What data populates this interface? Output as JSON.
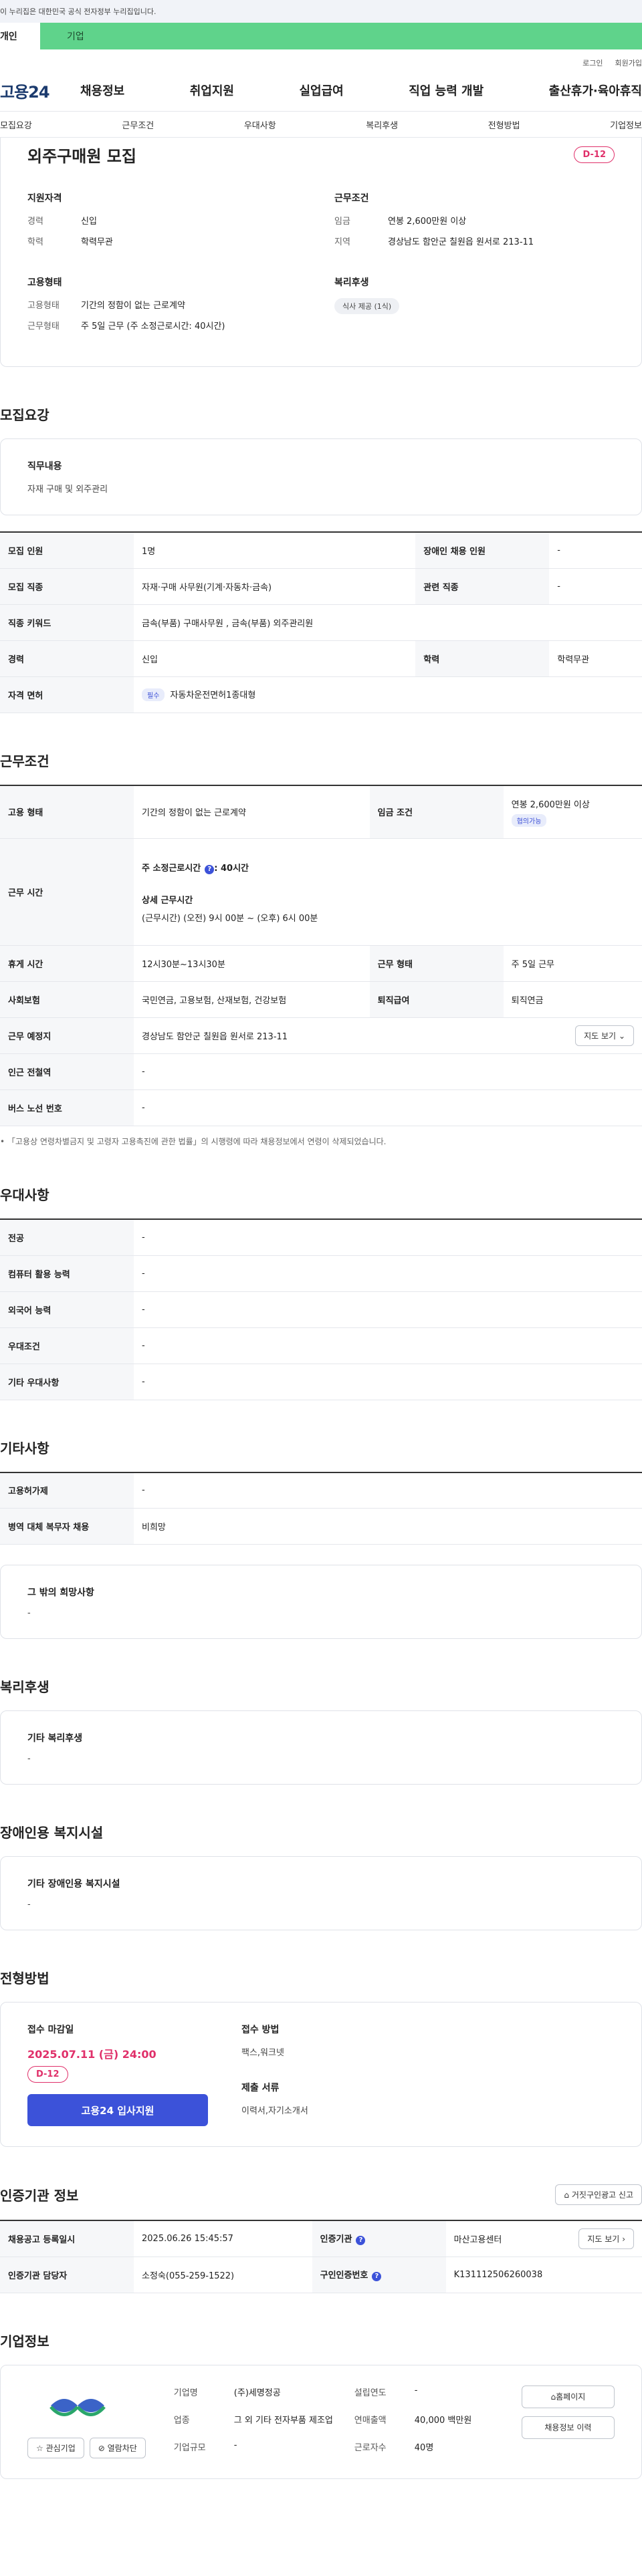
{
  "gov_bar": {
    "text": "이 누리집은 대한민국 공식 전자정부 누리집입니다."
  },
  "tabs": {
    "personal": "개인",
    "company": "기업"
  },
  "util": {
    "login": "로그인",
    "join": "회원가입"
  },
  "logo": "고용24",
  "main_menu": [
    "채용정보",
    "취업지원",
    "실업급여",
    "직업 능력 개발",
    "출산휴가·육아휴직"
  ],
  "sub_menu": [
    "모집요강",
    "근무조건",
    "우대사항",
    "복리후생",
    "전형방법",
    "기업정보"
  ],
  "summary": {
    "title": "외주구매원 모집",
    "dday": "D-12",
    "qualification": {
      "title": "지원자격",
      "career_k": "경력",
      "career_v": "신입",
      "edu_k": "학력",
      "edu_v": "학력무관"
    },
    "conditions": {
      "title": "근무조건",
      "wage_k": "임금",
      "wage_v": "연봉 2,600만원 이상",
      "region_k": "지역",
      "region_v": "경상남도 함안군 칠원읍 원서로 213-11"
    },
    "employment": {
      "title": "고용형태",
      "type_k": "고용형태",
      "type_v": "기간의 정함이 없는 근로계약",
      "work_k": "근무형태",
      "work_v": "주 5일 근무 (주 소정근로시간: 40시간)"
    },
    "welfare": {
      "title": "복리후생",
      "chip": "식사 제공 (1식)"
    }
  },
  "recruit": {
    "section": "모집요강",
    "duty_label": "직무내용",
    "duty_value": "자재 구매 및 외주관리",
    "rows": {
      "headcount_k": "모집 인원",
      "headcount_v": "1명",
      "disabled_k": "장애인 채용 인원",
      "disabled_v": "-",
      "job_k": "모집 직종",
      "job_v": "자재·구매 사무원(기계·자동차·금속)",
      "related_k": "관련 직종",
      "related_v": "-",
      "keyword_k": "직종 키워드",
      "keyword_v": "금속(부품) 구매사무원 , 금속(부품) 외주관리원",
      "career_k": "경력",
      "career_v": "신입",
      "edu_k": "학력",
      "edu_v": "학력무관",
      "license_k": "자격 면허",
      "license_tag": "필수",
      "license_v": "자동차운전면허1종대형"
    }
  },
  "work": {
    "section": "근무조건",
    "type_k": "고용 형태",
    "type_v": "기간의 정함이 없는 근로계약",
    "wage_k": "임금 조건",
    "wage_v": "연봉 2,600만원 이상",
    "wage_tag": "협의가능",
    "hours_k": "근무 시간",
    "hours_total": "주 소정근로시간",
    "hours_total_v": ": 40시간",
    "hours_detail_title": "상세 근무시간",
    "hours_detail_v": "(근무시간) (오전) 9시 00분 ~ (오후) 6시 00분",
    "break_k": "휴게 시간",
    "break_v": "12시30분~13시30분",
    "shift_k": "근무 형태",
    "shift_v": "주 5일 근무",
    "insurance_k": "사회보험",
    "insurance_v": "국민연금, 고용보험, 산재보험, 건강보험",
    "severance_k": "퇴직급여",
    "severance_v": "퇴직연금",
    "place_k": "근무 예정지",
    "place_v": "경상남도 함안군 칠원읍 원서로 213-11",
    "map_btn": "지도 보기",
    "station_k": "인근 전철역",
    "station_v": "-",
    "bus_k": "버스 노선 번호",
    "bus_v": "-",
    "note": "「고용상 연령차별금지 및 고령자 고용촉진에 관한 법률」의 시행령에 따라 채용정보에서 연령이 삭제되었습니다."
  },
  "preference": {
    "section": "우대사항",
    "major_k": "전공",
    "major_v": "-",
    "computer_k": "컴퓨터 활용 능력",
    "computer_v": "-",
    "lang_k": "외국어 능력",
    "lang_v": "-",
    "cond_k": "우대조건",
    "cond_v": "-",
    "etc_k": "기타 우대사항",
    "etc_v": "-"
  },
  "other": {
    "section": "기타사항",
    "subsidy_k": "고용허가제",
    "subsidy_v": "-",
    "military_k": "병역 대체 복무자 채용",
    "military_v": "비희망",
    "wish_label": "그 밖의 희망사항",
    "wish_v": "-"
  },
  "benefits": {
    "section": "복리후생",
    "label": "기타 복리후생",
    "value": "-"
  },
  "disabled_facility": {
    "section": "장애인용 복지시설",
    "label": "기타 장애인용 복지시설",
    "value": "-"
  },
  "selection": {
    "section": "전형방법",
    "deadline_label": "접수 마감일",
    "deadline": "2025.07.11 (금) 24:00",
    "dday": "D-12",
    "apply_btn": "고용24 입사지원",
    "method_label": "접수 방법",
    "method_v": "팩스,워크넷",
    "docs_label": "제출 서류",
    "docs_v": "이력서,자기소개서"
  },
  "agency": {
    "section": "인증기관 정보",
    "report_btn": "거짓구인광고 신고",
    "date_k": "채용공고 등록일시",
    "date_v": "2025.06.26 15:45:57",
    "org_k": "인증기관",
    "org_v": "마산고용센터",
    "map_btn": "지도 보기",
    "manager_k": "인증기관 담당자",
    "manager_v": "소정숙(055-259-1522)",
    "number_k": "구인인증번호",
    "number_v": "K131112506260038"
  },
  "company": {
    "section": "기업정보",
    "fav_btn": "관심기업",
    "block_btn": "열람차단",
    "name_k": "기업명",
    "name_v": "(주)세명정공",
    "year_k": "설립연도",
    "year_v": "-",
    "biz_k": "업종",
    "biz_v": "그 외 기타 전자부품 제조업",
    "sales_k": "연매출액",
    "sales_v": "40,000 백만원",
    "emp_k": "근로자수",
    "emp_v": "40명",
    "size_k": "기업규모",
    "size_v": "-",
    "home_btn": "홈페이지",
    "info_btn": "채용정보 이력"
  }
}
